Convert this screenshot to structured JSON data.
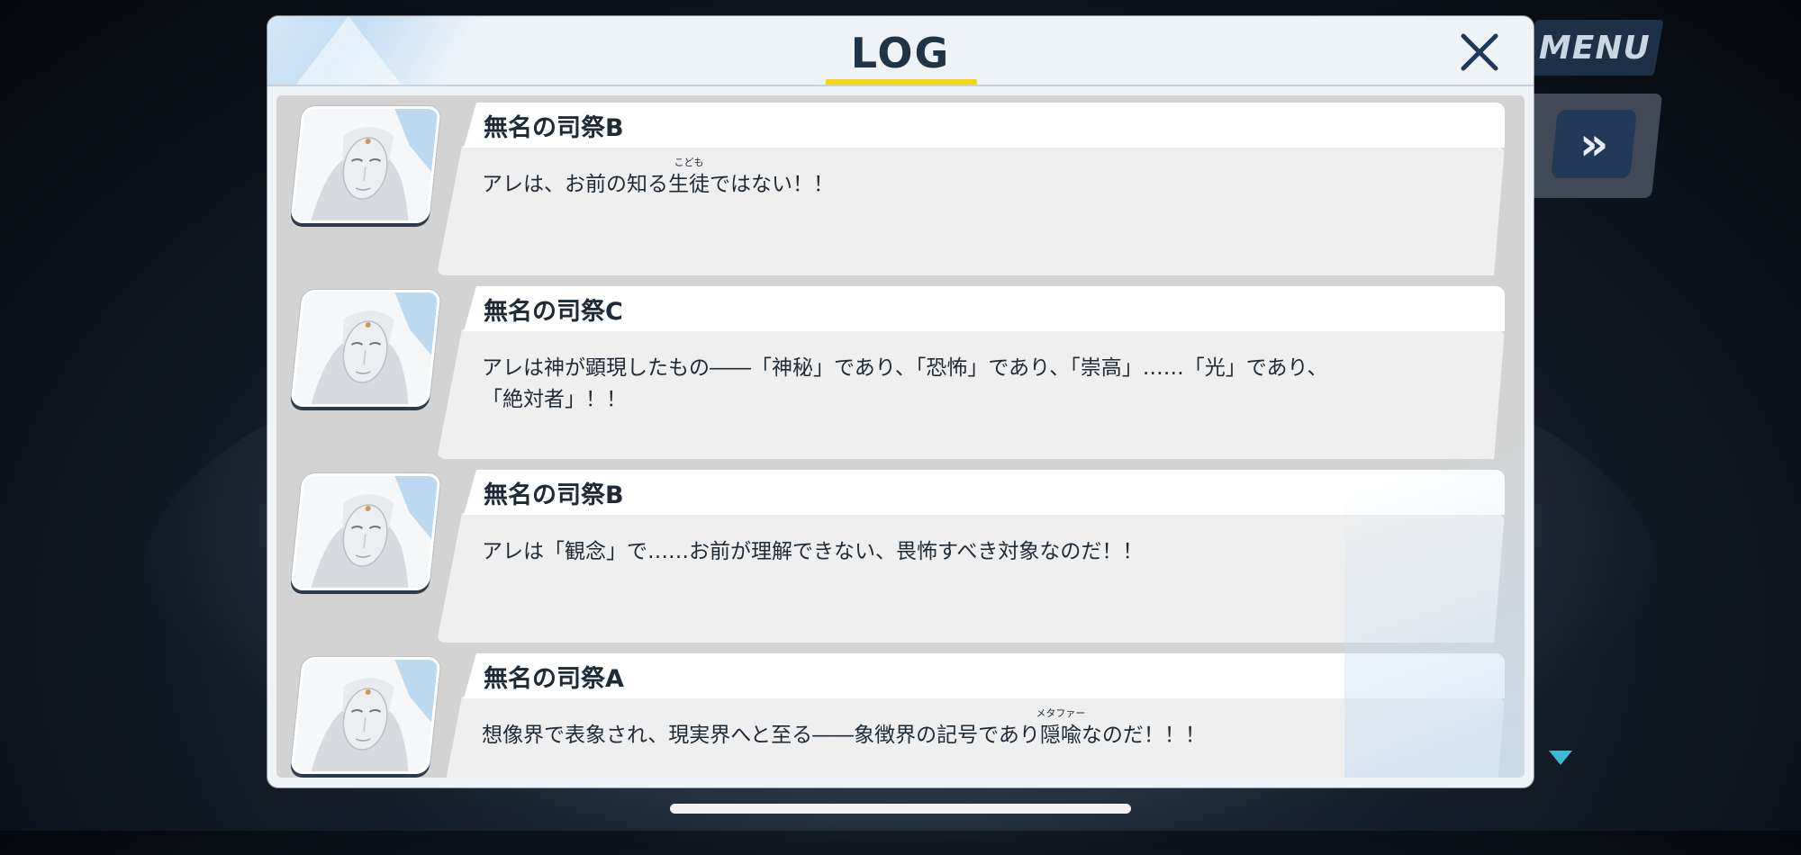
{
  "window": {
    "title": "LOG",
    "close_icon": "close-icon"
  },
  "menu": {
    "label": "MENU"
  },
  "controls": {
    "fast_forward_glyph": "»",
    "next_indicator_icon": "triangle-down-icon"
  },
  "entries": [
    {
      "speaker": "無名の司祭B",
      "avatar_icon": "masked-priest-avatar",
      "line1": {
        "before": "アレは、お前の知る",
        "ruby_base": "生徒",
        "ruby_text": "こども",
        "after": "ではない！！"
      }
    },
    {
      "speaker": "無名の司祭C",
      "avatar_icon": "masked-priest-avatar",
      "line1": "アレは神が顕現したもの――「神秘」であり、「恐怖」であり、「崇高」……「光」であり、",
      "line2": "「絶対者」！！"
    },
    {
      "speaker": "無名の司祭B",
      "avatar_icon": "masked-priest-avatar",
      "line1": "アレは「観念」で……お前が理解できない、畏怖すべき対象なのだ！！"
    },
    {
      "speaker": "無名の司祭A",
      "avatar_icon": "masked-priest-avatar",
      "line1": {
        "before": "想像界で表象され、現実界へと至る――象徴界の記号であり",
        "ruby_base": "隠喩",
        "ruby_text": "メタファー",
        "after": "なのだ！！！"
      }
    }
  ],
  "colors": {
    "title_underline": "#f5d60f",
    "accent_blue": "#3fb8d6",
    "text": "#1e2a36"
  }
}
